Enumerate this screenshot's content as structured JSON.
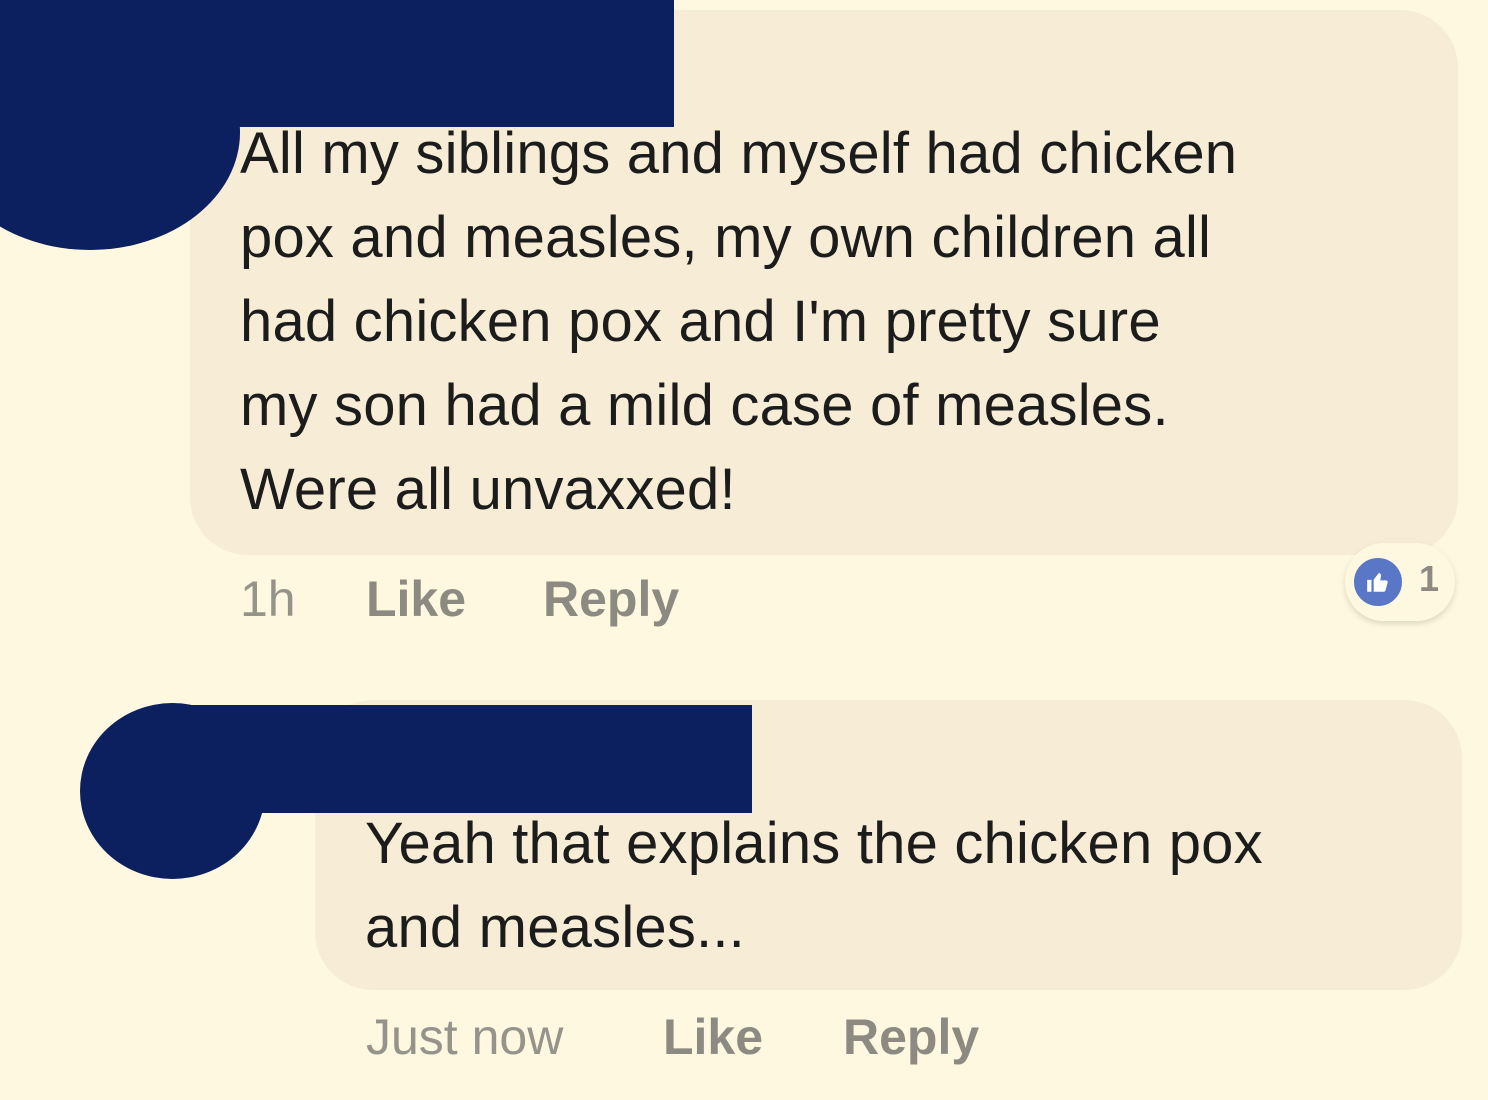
{
  "comments": [
    {
      "text": "All my siblings and myself had chicken\npox and measles,  my own children all\nhad chicken pox and I'm pretty sure\nmy son had a mild case of measles.\nWere all unvaxxed!",
      "timestamp": "1h",
      "like_label": "Like",
      "reply_label": "Reply",
      "reaction_count": "1",
      "reaction_icon": "thumbs-up-icon"
    },
    {
      "text": "Yeah that explains the chicken pox\nand measles...",
      "timestamp": "Just now",
      "like_label": "Like",
      "reply_label": "Reply"
    }
  ],
  "colors": {
    "background": "#fdf8df",
    "bubble": "#f7edd6",
    "redaction": "#0c1f5e",
    "like_badge": "#5a76c6",
    "text": "#1c1c1c",
    "meta_text": "#8d8a82"
  }
}
